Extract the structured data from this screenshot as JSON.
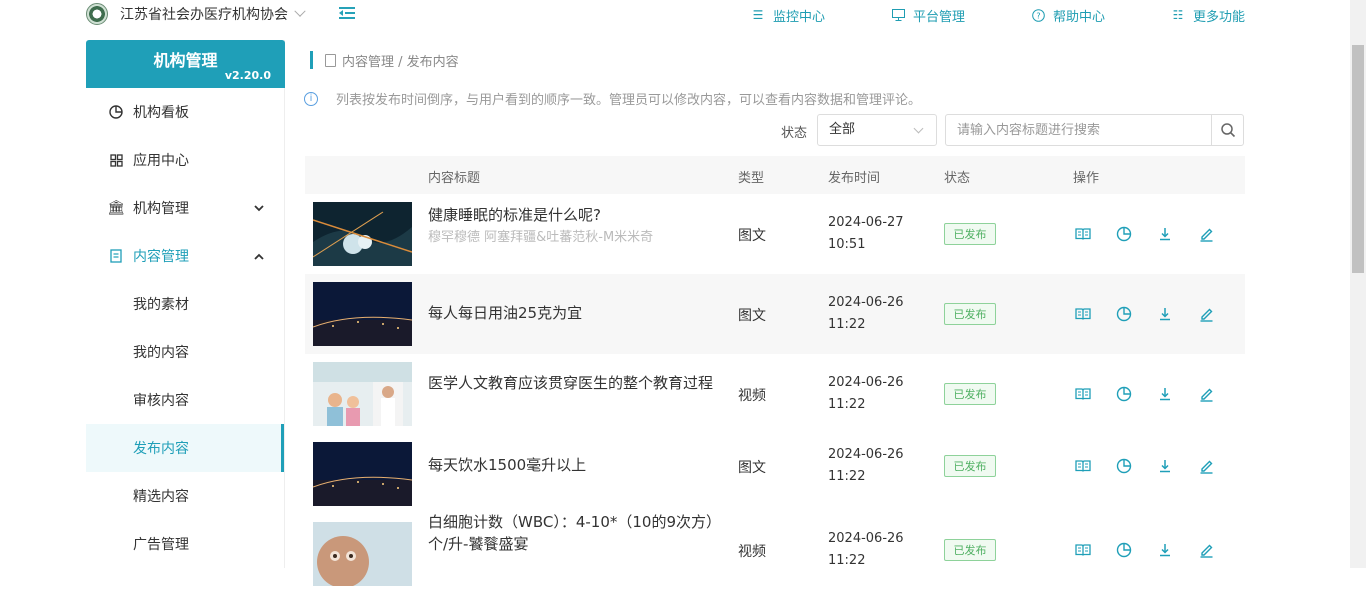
{
  "org": {
    "name": "江苏省社会办医疗机构协会"
  },
  "topnav": [
    {
      "label": "监控中心",
      "icon": "monitor-list-icon"
    },
    {
      "label": "平台管理",
      "icon": "desktop-icon"
    },
    {
      "label": "帮助中心",
      "icon": "help-circle-icon"
    },
    {
      "label": "更多功能",
      "icon": "more-list-icon"
    }
  ],
  "sidebar": {
    "brand_title": "机构管理",
    "version": "v2.20.0",
    "items": [
      {
        "label": "机构看板",
        "icon": "pie-chart-icon"
      },
      {
        "label": "应用中心",
        "icon": "grid-icon"
      },
      {
        "label": "机构管理",
        "icon": "bank-icon"
      },
      {
        "label": "内容管理",
        "icon": "document-icon"
      }
    ],
    "sub_items": [
      "我的素材",
      "我的内容",
      "审核内容",
      "发布内容",
      "精选内容",
      "广告管理"
    ]
  },
  "breadcrumb": "内容管理 / 发布内容",
  "info_text": "列表按发布时间倒序，与用户看到的顺序一致。管理员可以修改内容，可以查看内容数据和管理评论。",
  "filter": {
    "status_label": "状态",
    "status_value": "全部",
    "search_placeholder": "请输入内容标题进行搜索"
  },
  "table": {
    "headers": {
      "title": "内容标题",
      "type": "类型",
      "time": "发布时间",
      "status": "状态",
      "ops": "操作"
    },
    "rows": [
      {
        "title": "健康睡眠的标准是什么呢?",
        "subtitle": "穆罕穆德 阿塞拜疆&吐蕃范秋-M米米奇",
        "type": "图文",
        "date": "2024-06-27",
        "clock": "10:51",
        "status": "已发布"
      },
      {
        "title": "每人每日用油25克为宜",
        "subtitle": "",
        "type": "图文",
        "date": "2024-06-26",
        "clock": "11:22",
        "status": "已发布"
      },
      {
        "title": "医学人文教育应该贯穿医生的整个教育过程",
        "subtitle": "",
        "type": "视频",
        "date": "2024-06-26",
        "clock": "11:22",
        "status": "已发布"
      },
      {
        "title": "每天饮水1500毫升以上",
        "subtitle": "",
        "type": "图文",
        "date": "2024-06-26",
        "clock": "11:22",
        "status": "已发布"
      },
      {
        "title": "白细胞计数（WBC）：4-10*（10的9次方）个/升-饕餮盛宴",
        "subtitle": "",
        "type": "视频",
        "date": "2024-06-26",
        "clock": "11:22",
        "status": "已发布"
      }
    ]
  },
  "colors": {
    "accent": "#1f9fb8",
    "published_green": "#4fb062"
  }
}
